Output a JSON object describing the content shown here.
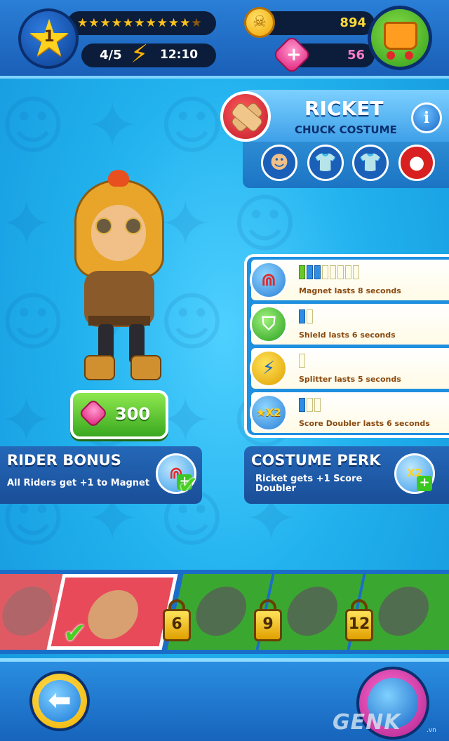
{
  "header": {
    "level": "1",
    "stars_filled": "★★★★★★★★★★",
    "stars_dim": "★",
    "energy": "4/5",
    "energy_timer": "12:10",
    "coins": "894",
    "gems": "56"
  },
  "character": {
    "name": "RICKET",
    "costume": "CHUCK COSTUME",
    "info_label": "i",
    "costume_slots": [
      "rider-face-icon",
      "pink-shirt-icon",
      "green-shirt-icon",
      "red-bird-icon"
    ]
  },
  "buy": {
    "price": "300"
  },
  "perks": [
    {
      "icon": "magnet-icon",
      "label": "Magnet lasts 8 seconds",
      "level": 3,
      "max": 8,
      "color": "mixed"
    },
    {
      "icon": "shield-icon",
      "label": "Shield lasts 6 seconds",
      "level": 1,
      "max": 2,
      "color": "blue"
    },
    {
      "icon": "splitter-coin-icon",
      "label": "Splitter lasts 5 seconds",
      "level": 0,
      "max": 1,
      "color": "blue"
    },
    {
      "icon": "score-doubler-icon",
      "label": "Score Doubler lasts 6 seconds",
      "level": 1,
      "max": 3,
      "color": "blue"
    }
  ],
  "rider_bonus": {
    "title": "RIDER BONUS",
    "text": "All Riders get +1 to Magnet"
  },
  "costume_perk": {
    "title": "COSTUME PERK",
    "text": "Ricket gets +1 Score Doubler",
    "icon_label": "X2"
  },
  "riders": [
    {
      "name": "rider-girl",
      "unlock_level": ""
    },
    {
      "name": "rider-ricket",
      "unlock_level": ""
    },
    {
      "name": "rider-locked-1",
      "unlock_level": "6"
    },
    {
      "name": "rider-locked-2",
      "unlock_level": "9"
    },
    {
      "name": "rider-locked-3",
      "unlock_level": "12"
    }
  ],
  "footer": {
    "back_icon": "back-arrow-icon",
    "watermark": "GENK",
    "watermark_small": ".vn"
  },
  "colors": {
    "accent_blue": "#1a6ec8",
    "rider_selected": "#e84a5a",
    "rider_locked": "#3aa830",
    "coin": "#ffd93a",
    "gem": "#ff7cc6"
  }
}
